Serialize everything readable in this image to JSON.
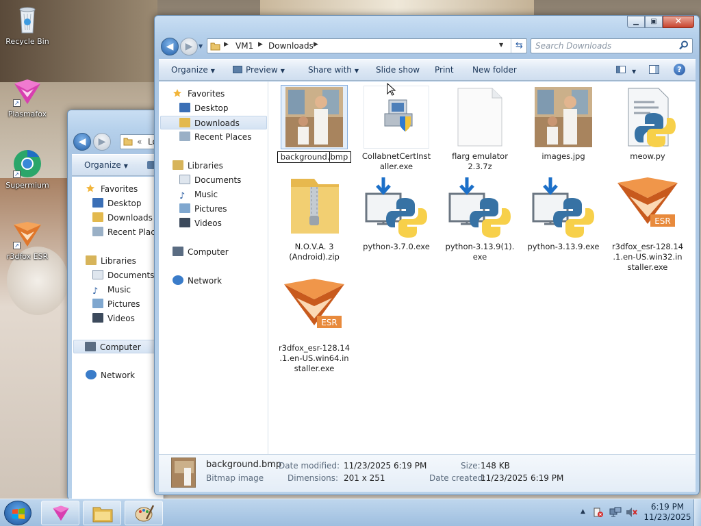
{
  "desktop": {
    "icons": [
      {
        "label": "Recycle Bin",
        "icon": "recycle-bin-icon"
      },
      {
        "label": "Plasmafox",
        "icon": "plasmafox-icon"
      },
      {
        "label": "Supermium",
        "icon": "supermium-icon"
      },
      {
        "label": "r3dfox ESR",
        "icon": "r3dfox-icon"
      }
    ]
  },
  "back_window": {
    "address_overflow": "«",
    "address_text": "Lo",
    "toolbar": {
      "organize": "Organize"
    },
    "nav": {
      "favorites": "Favorites",
      "desktop": "Desktop",
      "downloads": "Downloads",
      "recent": "Recent Places",
      "libraries": "Libraries",
      "documents": "Documents",
      "music": "Music",
      "pictures": "Pictures",
      "videos": "Videos",
      "computer": "Computer",
      "network": "Network"
    }
  },
  "window": {
    "breadcrumb": [
      "VM1",
      "Downloads"
    ],
    "search_placeholder": "Search Downloads",
    "toolbar": {
      "organize": "Organize",
      "preview": "Preview",
      "share_with": "Share with",
      "slide_show": "Slide show",
      "print": "Print",
      "new_folder": "New folder"
    },
    "nav": {
      "favorites": "Favorites",
      "desktop": "Desktop",
      "downloads": "Downloads",
      "recent": "Recent Places",
      "libraries": "Libraries",
      "documents": "Documents",
      "music": "Music",
      "pictures": "Pictures",
      "videos": "Videos",
      "computer": "Computer",
      "network": "Network"
    },
    "files": [
      {
        "name": "background.bmp",
        "rename_left": "background.",
        "rename_right": "bmp",
        "icon": "image-thumbnail-icon"
      },
      {
        "name": "CollabnetCertInstaller.exe",
        "line1": "CollabnetCertInst",
        "line2": "aller.exe",
        "icon": "installer-icon"
      },
      {
        "name": "flarg emulator 2.3.7z",
        "line1": "flarg emulator",
        "line2": "2.3.7z",
        "icon": "blank-file-icon"
      },
      {
        "name": "images.jpg",
        "line1": "images.jpg",
        "icon": "image-thumbnail-icon"
      },
      {
        "name": "meow.py",
        "line1": "meow.py",
        "icon": "python-file-icon"
      },
      {
        "name": "N.O.V.A. 3 (Android).zip",
        "line1": "N.O.V.A. 3",
        "line2": "(Android).zip",
        "icon": "zip-folder-icon"
      },
      {
        "name": "python-3.7.0.exe",
        "line1": "python-3.7.0.exe",
        "icon": "python-installer-icon"
      },
      {
        "name": "python-3.13.9(1).exe",
        "line1": "python-3.13.9(1).",
        "line2": "exe",
        "icon": "python-installer-icon"
      },
      {
        "name": "python-3.13.9.exe",
        "line1": "python-3.13.9.exe",
        "icon": "python-installer-icon"
      },
      {
        "name": "r3dfox_esr-128.14.1.en-US.win32.installer.exe",
        "line1": "r3dfox_esr-128.14",
        "line2": ".1.en-US.win32.in",
        "line3": "staller.exe",
        "icon": "r3dfox-esr-icon"
      },
      {
        "name": "r3dfox_esr-128.14.1.en-US.win64.installer.exe",
        "line1": "r3dfox_esr-128.14",
        "line2": ".1.en-US.win64.in",
        "line3": "staller.exe",
        "icon": "r3dfox-esr-icon"
      }
    ],
    "details": {
      "filename": "background.bmp",
      "type": "Bitmap image",
      "date_modified_label": "Date modified:",
      "date_modified": "11/23/2025 6:19 PM",
      "dimensions_label": "Dimensions:",
      "dimensions": "201 x 251",
      "size_label": "Size:",
      "size": "148 KB",
      "date_created_label": "Date created:",
      "date_created": "11/23/2025 6:19 PM"
    }
  },
  "taskbar": {
    "clock_time": "6:19 PM",
    "clock_date": "11/23/2025"
  },
  "colors": {
    "accent": "#2460a9",
    "python_blue": "#3772a4",
    "python_yellow": "#f7d04a",
    "esr_orange": "#e0772b"
  }
}
